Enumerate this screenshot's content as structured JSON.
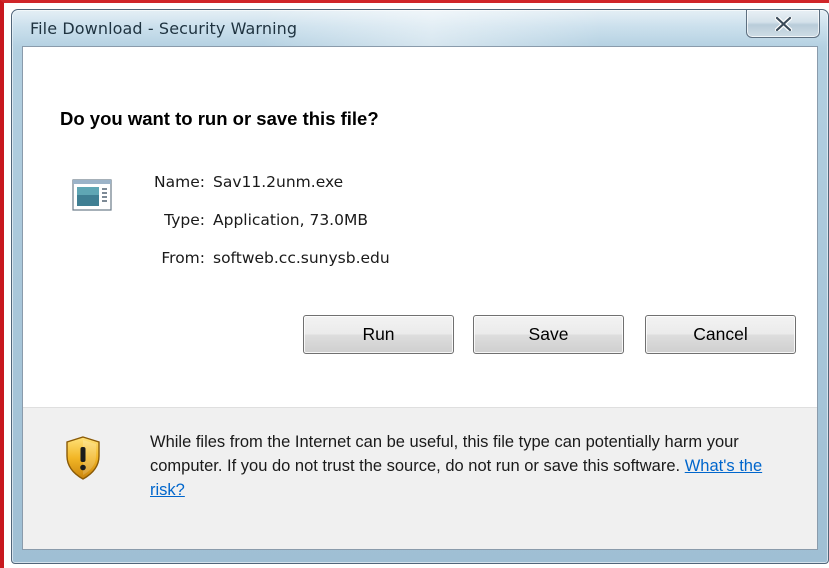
{
  "window": {
    "title": "File Download - Security Warning"
  },
  "dialog": {
    "heading": "Do you want to run or save this file?",
    "file": {
      "name_label": "Name:",
      "name_value": "Sav11.2unm.exe",
      "type_label": "Type:",
      "type_value": "Application, 73.0MB",
      "from_label": "From:",
      "from_value": "softweb.cc.sunysb.edu"
    },
    "buttons": {
      "run": "Run",
      "save": "Save",
      "cancel": "Cancel"
    },
    "warning": {
      "text": "While files from the Internet can be useful, this file type can potentially harm your computer. If you do not trust the source, do not run or save this software.",
      "link": "What's the risk?"
    }
  },
  "icons": {
    "close": "close-icon",
    "file": "application-file-icon",
    "shield": "security-shield-icon"
  },
  "colors": {
    "frame_highlight": "#c8181e",
    "title_bar": "#b2cfe0",
    "link": "#0066cc",
    "shield_gold": "#e8a81a"
  }
}
